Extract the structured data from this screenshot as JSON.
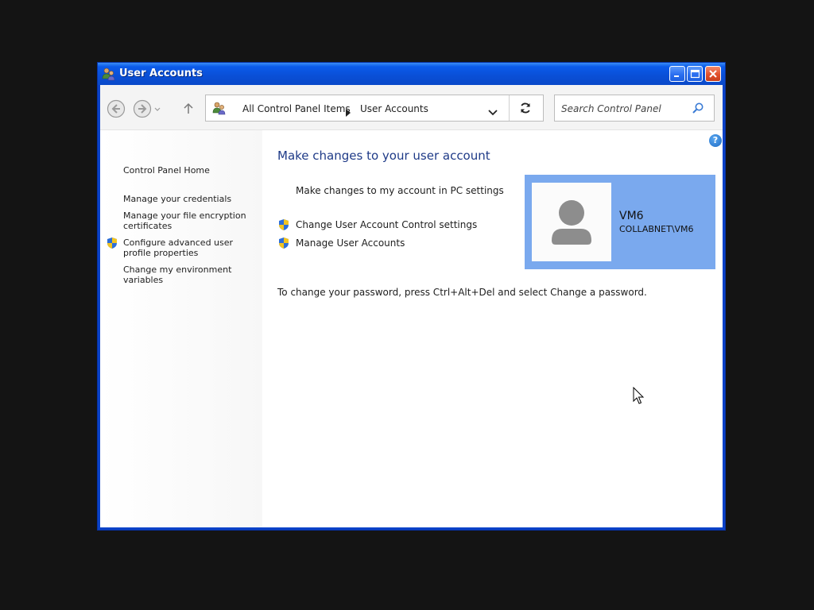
{
  "window": {
    "title": "User Accounts",
    "controls": {
      "minimize": "minimize",
      "maximize": "maximize",
      "close": "close"
    }
  },
  "navigation": {
    "breadcrumb": [
      "All Control Panel Items",
      "User Accounts"
    ],
    "search_placeholder": "Search Control Panel"
  },
  "sidebar": {
    "home": "Control Panel Home",
    "links": [
      "Manage your credentials",
      "Manage your file encryption certificates",
      "Configure advanced user profile properties",
      "Change my environment variables"
    ]
  },
  "main": {
    "heading": "Make changes to your user account",
    "pc_settings_link": "Make changes to my account in PC settings",
    "uac_link": "Change User Account Control settings",
    "manage_link": "Manage User Accounts",
    "password_note": "To change your password, press Ctrl+Alt+Del and select Change a password."
  },
  "user": {
    "name": "VM6",
    "domain": "COLLABNET\\VM6"
  },
  "colors": {
    "titlebar": "#0b5bea",
    "tile": "#7aa9ee",
    "heading": "#1e3a87",
    "desktop": "#141414"
  }
}
